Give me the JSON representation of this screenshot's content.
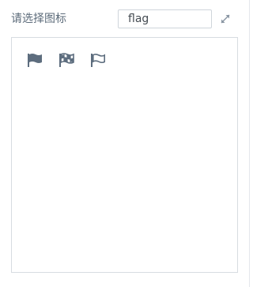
{
  "header": {
    "title": "请选择图标"
  },
  "search": {
    "value": "flag"
  },
  "actions": {
    "expand_icon": "expand-icon"
  },
  "results": {
    "icons": [
      {
        "name": "flag-solid-icon"
      },
      {
        "name": "flag-checkered-icon"
      },
      {
        "name": "flag-outline-icon"
      }
    ]
  },
  "colors": {
    "icon": "#5d6d7e",
    "text": "#5c6b7a",
    "border": "#d7dce1"
  }
}
